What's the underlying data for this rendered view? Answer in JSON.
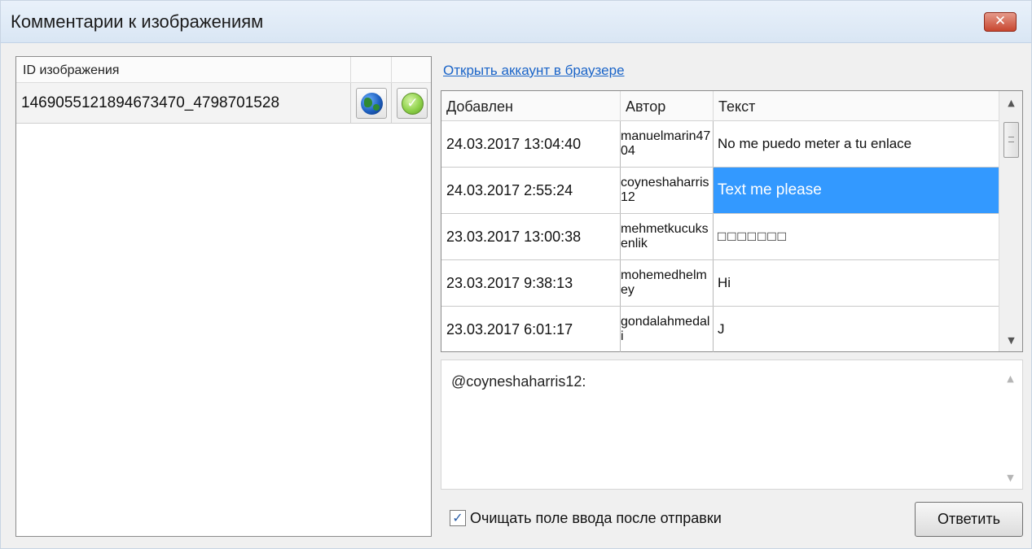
{
  "window": {
    "title": "Комментарии к изображениям",
    "close_glyph": "✕"
  },
  "images": {
    "header": "ID изображения",
    "rows": [
      {
        "id": "1469055121894673470_4798701528",
        "globe_icon": "globe-icon",
        "check_icon": "check-icon"
      }
    ]
  },
  "link": "Открыть аккаунт в браузере",
  "comments": {
    "headers": {
      "date": "Добавлен",
      "author": "Автор",
      "text": "Текст"
    },
    "rows": [
      {
        "date": "24.03.2017 13:04:40",
        "author": "manuelmarin4704",
        "text": "No me puedo meter a tu enlace",
        "selected": false
      },
      {
        "date": "24.03.2017 2:55:24",
        "author": "coyneshaharris12",
        "text": "Text me please",
        "selected": true
      },
      {
        "date": "23.03.2017 13:00:38",
        "author": "mehmetkucuksenlik",
        "text": "□□□□□□□",
        "selected": false
      },
      {
        "date": "23.03.2017 9:38:13",
        "author": "mohemedhelmey",
        "text": "Hi",
        "selected": false
      },
      {
        "date": "23.03.2017 6:01:17",
        "author": "gondalahmedali",
        "text": "J",
        "selected": false
      }
    ],
    "selection_color": "#3399ff"
  },
  "reply": {
    "value": "@coyneshaharris12:"
  },
  "clear_after_send": {
    "label": "Очищать поле ввода после отправки",
    "checked": true,
    "glyph": "✓"
  },
  "send_button": {
    "label": "Ответить"
  },
  "scroll_glyphs": {
    "up": "▲",
    "down": "▼"
  }
}
